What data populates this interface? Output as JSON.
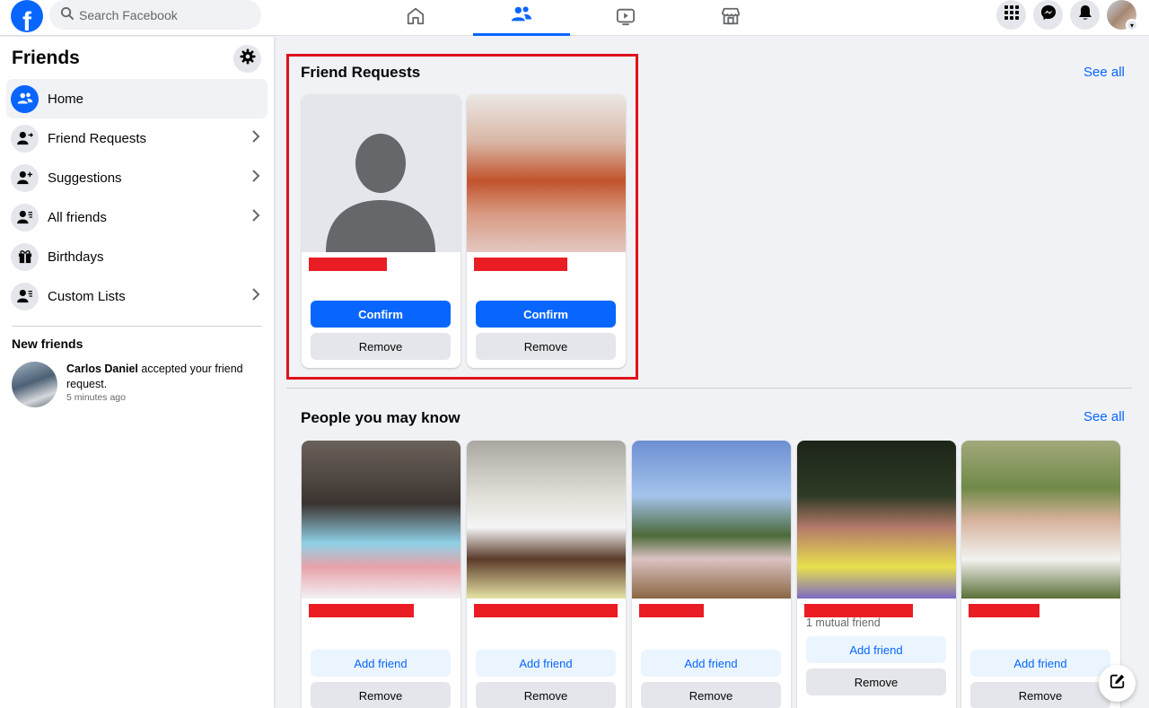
{
  "topbar": {
    "logo_letter": "f",
    "search_placeholder": "Search Facebook"
  },
  "sidebar": {
    "title": "Friends",
    "items": [
      {
        "label": "Home"
      },
      {
        "label": "Friend Requests"
      },
      {
        "label": "Suggestions"
      },
      {
        "label": "All friends"
      },
      {
        "label": "Birthdays"
      },
      {
        "label": "Custom Lists"
      }
    ],
    "new_friends_title": "New friends",
    "notification": {
      "name": "Carlos Daniel",
      "text": " accepted your friend request.",
      "time": "5 minutes ago"
    }
  },
  "friend_requests": {
    "title": "Friend Requests",
    "see_all": "See all",
    "confirm_label": "Confirm",
    "remove_label": "Remove"
  },
  "people_you_may_know": {
    "title": "People you may know",
    "see_all": "See all",
    "add_label": "Add friend",
    "remove_label": "Remove",
    "mutual_text": "1 mutual friend"
  },
  "colors": {
    "accent": "#0866ff",
    "highlight": "#e0121b",
    "redaction": "#ea1c24"
  }
}
